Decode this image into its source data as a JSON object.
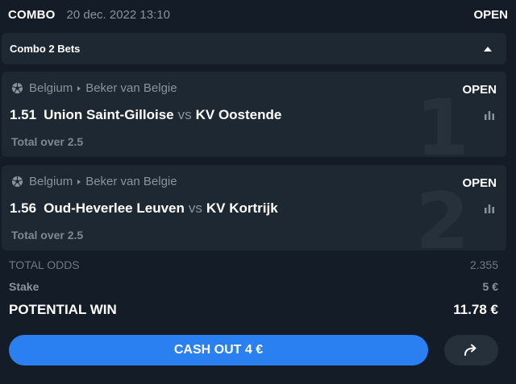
{
  "header": {
    "bet_type": "COMBO",
    "date": "20 dec. 2022 13:10",
    "status": "OPEN"
  },
  "combo": {
    "title": "Combo 2 Bets",
    "toggle_icon": "caret-up-icon"
  },
  "bets": [
    {
      "sport_icon": "soccer-ball-icon",
      "country": "Belgium",
      "competition": "Beker van Belgie",
      "status": "OPEN",
      "odds": "1.51",
      "home": "Union Saint-Gilloise",
      "vs": "vs",
      "away": "KV Oostende",
      "market": "Total over 2.5",
      "index": "1",
      "stats_icon": "bar-chart-icon"
    },
    {
      "sport_icon": "soccer-ball-icon",
      "country": "Belgium",
      "competition": "Beker van Belgie",
      "status": "OPEN",
      "odds": "1.56",
      "home": "Oud-Heverlee Leuven",
      "vs": "vs",
      "away": "KV Kortrijk",
      "market": "Total over 2.5",
      "index": "2",
      "stats_icon": "bar-chart-icon"
    }
  ],
  "summary": {
    "total_odds_label": "TOTAL ODDS",
    "total_odds_value": "2.355",
    "stake_label": "Stake",
    "stake_value": "5 €",
    "potential_win_label": "POTENTIAL WIN",
    "potential_win_value": "11.78 €"
  },
  "actions": {
    "cashout_label": "CASH OUT 4 €",
    "share_icon": "share-arrow-icon"
  },
  "colors": {
    "background": "#141d27",
    "card": "#1e2833",
    "accent": "#2a7ff1",
    "muted_text": "#8a939d"
  }
}
